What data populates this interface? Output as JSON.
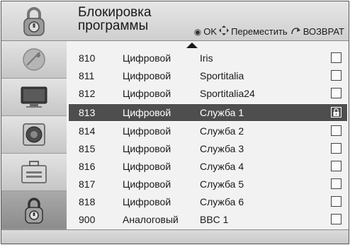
{
  "header": {
    "title_line1": "Блокировка",
    "title_line2": "программы",
    "hint_ok": "OK",
    "hint_move": "Переместить",
    "hint_back": "ВОЗВРАТ"
  },
  "sidebar": {
    "items": [
      {
        "icon": "satellite-dish-icon"
      },
      {
        "icon": "tv-icon"
      },
      {
        "icon": "speaker-icon"
      },
      {
        "icon": "toolbox-icon"
      },
      {
        "icon": "lock-icon",
        "active": true
      }
    ]
  },
  "channels": [
    {
      "number": "810",
      "type": "Цифровой",
      "name": "Iris",
      "locked": false
    },
    {
      "number": "811",
      "type": "Цифровой",
      "name": "Sportitalia",
      "locked": false
    },
    {
      "number": "812",
      "type": "Цифровой",
      "name": "Sportitalia24",
      "locked": false
    },
    {
      "number": "813",
      "type": "Цифровой",
      "name": "Служба 1",
      "locked": true,
      "selected": true
    },
    {
      "number": "814",
      "type": "Цифровой",
      "name": "Служба 2",
      "locked": false
    },
    {
      "number": "815",
      "type": "Цифровой",
      "name": "Служба 3",
      "locked": false
    },
    {
      "number": "816",
      "type": "Цифровой",
      "name": "Служба 4",
      "locked": false
    },
    {
      "number": "817",
      "type": "Цифровой",
      "name": "Служба 5",
      "locked": false
    },
    {
      "number": "818",
      "type": "Цифровой",
      "name": "Служба 6",
      "locked": false
    },
    {
      "number": "900",
      "type": "Аналоговый",
      "name": "BBC 1",
      "locked": false
    }
  ]
}
